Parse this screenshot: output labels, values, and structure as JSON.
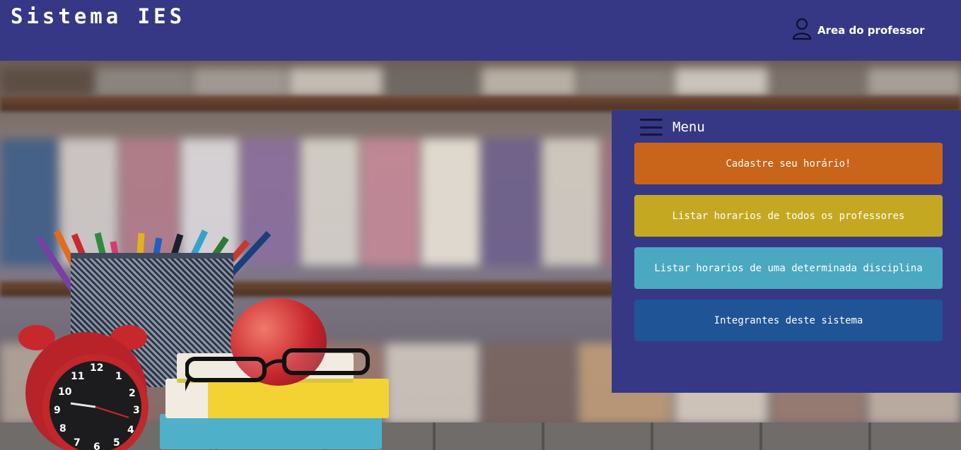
{
  "header": {
    "brand": "Sistema IES",
    "professor_link": "Area do professor",
    "professor_icon": "user-icon",
    "background_color": "#363885"
  },
  "menu": {
    "title": "Menu",
    "icon": "hamburger-icon",
    "background_color": "#363885",
    "buttons": [
      {
        "label": "Cadastre seu horário!",
        "color": "#c9651a"
      },
      {
        "label": "Listar horarios de todos os professores",
        "color": "#c5a821"
      },
      {
        "label": "Listar horarios de uma determinada disciplina",
        "color": "#4ba8c1"
      },
      {
        "label": "Integrantes deste sistema",
        "color": "#1f5497"
      }
    ]
  },
  "clock": {
    "numbers": [
      "12",
      "1",
      "2",
      "3",
      "4",
      "5",
      "6",
      "7",
      "8",
      "9",
      "10",
      "11"
    ]
  }
}
